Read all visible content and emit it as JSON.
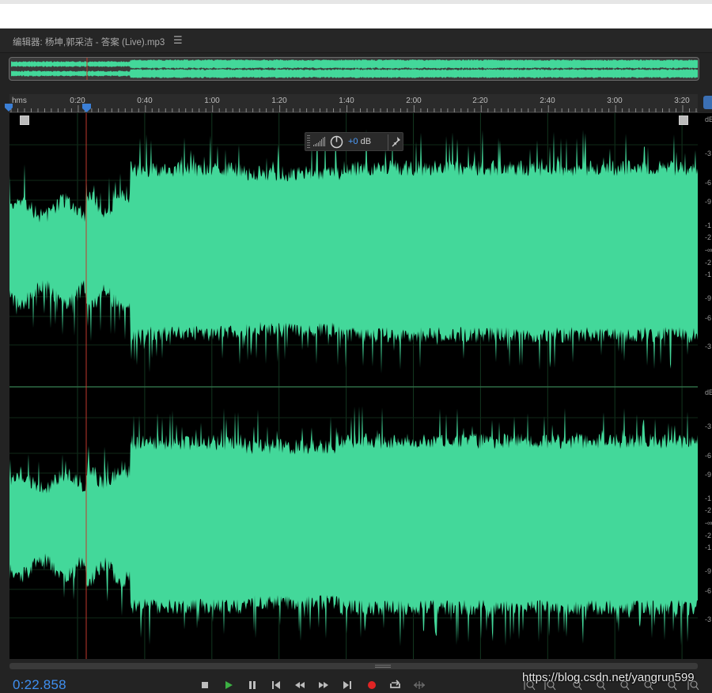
{
  "panel": {
    "title": "编辑器: 杨坤,郭采洁 - 答案 (Live).mp3",
    "menu_icon": "hamburger-icon"
  },
  "ruler": {
    "unit_label": "hms",
    "ticks": [
      "0:20",
      "0:40",
      "1:00",
      "1:20",
      "1:40",
      "2:00",
      "2:20",
      "2:40",
      "3:00",
      "3:20"
    ]
  },
  "hud": {
    "volume_prefix": "+0",
    "volume_unit": " dB"
  },
  "db_scale": {
    "labels": [
      "dB",
      "-3",
      "-6",
      "-9",
      "-1",
      "-2",
      "-∞",
      "-2",
      "-1",
      "-9",
      "-6",
      "-3"
    ]
  },
  "playhead_time": "0:22.858",
  "transport": [
    "stop-icon",
    "play-icon",
    "pause-icon",
    "skip-to-start-icon",
    "rewind-icon",
    "fast-forward-icon",
    "skip-to-end-icon",
    "record-icon",
    "loop-icon",
    "skip-selection-icon"
  ],
  "zoom_controls": [
    "zoom-in-amplitude-icon",
    "zoom-out-amplitude-icon",
    "zoom-in-time-icon",
    "zoom-out-time-icon",
    "zoom-out-full-icon",
    "zoom-in-point-icon",
    "zoom-selection-icon",
    "zoom-left-edge-icon",
    "zoom-right-edge-icon"
  ],
  "watermark": "https://blog.csdn.net/yangrun599",
  "colors": {
    "waveform": "#43d89a",
    "playhead": "#c0392b",
    "time_display": "#3f8ff0",
    "accent": "#4d9eff"
  }
}
